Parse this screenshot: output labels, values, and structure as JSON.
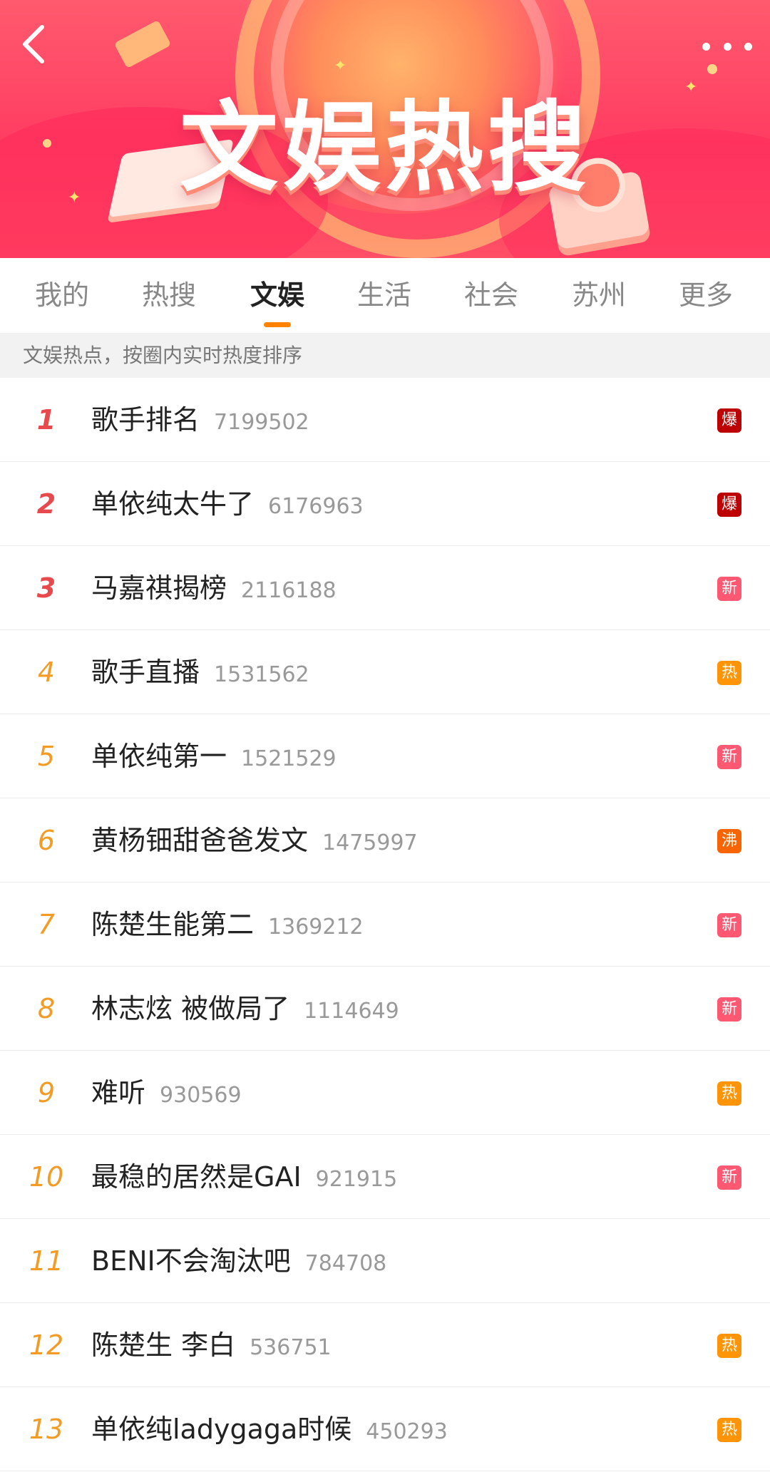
{
  "header": {
    "banner_title": "文娱热搜",
    "back_icon": "chevron-left-icon",
    "more_icon": "more-horizontal-icon"
  },
  "tabs": [
    {
      "label": "我的",
      "active": false
    },
    {
      "label": "热搜",
      "active": false
    },
    {
      "label": "文娱",
      "active": true
    },
    {
      "label": "生活",
      "active": false
    },
    {
      "label": "社会",
      "active": false
    },
    {
      "label": "苏州",
      "active": false
    },
    {
      "label": "更多",
      "active": false
    }
  ],
  "subtitle": "文娱热点，按圈内实时热度排序",
  "colors": {
    "accent": "#ff8200",
    "rank_top": "#e8494d",
    "rank_other": "#f39b25",
    "badge_bao": "#bd0000",
    "badge_xin": "#ff3852",
    "badge_re": "#ff9406",
    "badge_fei": "#f86400"
  },
  "items": [
    {
      "rank": "1",
      "topic": "歌手排名",
      "count": "7199502",
      "badge": "爆",
      "badge_color": "#bd0000"
    },
    {
      "rank": "2",
      "topic": "单依纯太牛了",
      "count": "6176963",
      "badge": "爆",
      "badge_color": "#bd0000"
    },
    {
      "rank": "3",
      "topic": "马嘉祺揭榜",
      "count": "2116188",
      "badge": "新",
      "badge_color": "#ff5873"
    },
    {
      "rank": "4",
      "topic": "歌手直播",
      "count": "1531562",
      "badge": "热",
      "badge_color": "#ff9406"
    },
    {
      "rank": "5",
      "topic": "单依纯第一",
      "count": "1521529",
      "badge": "新",
      "badge_color": "#ff5873"
    },
    {
      "rank": "6",
      "topic": "黄杨钿甜爸爸发文",
      "count": "1475997",
      "badge": "沸",
      "badge_color": "#f86400"
    },
    {
      "rank": "7",
      "topic": "陈楚生能第二",
      "count": "1369212",
      "badge": "新",
      "badge_color": "#ff5873"
    },
    {
      "rank": "8",
      "topic": "林志炫 被做局了",
      "count": "1114649",
      "badge": "新",
      "badge_color": "#ff5873"
    },
    {
      "rank": "9",
      "topic": "难听",
      "count": "930569",
      "badge": "热",
      "badge_color": "#ff9406"
    },
    {
      "rank": "10",
      "topic": "最稳的居然是GAI",
      "count": "921915",
      "badge": "新",
      "badge_color": "#ff5873"
    },
    {
      "rank": "11",
      "topic": "BENI不会淘汰吧",
      "count": "784708",
      "badge": "",
      "badge_color": ""
    },
    {
      "rank": "12",
      "topic": "陈楚生 李白",
      "count": "536751",
      "badge": "热",
      "badge_color": "#ff9406"
    },
    {
      "rank": "13",
      "topic": "单依纯ladygaga时候",
      "count": "450293",
      "badge": "热",
      "badge_color": "#ff9406"
    }
  ]
}
